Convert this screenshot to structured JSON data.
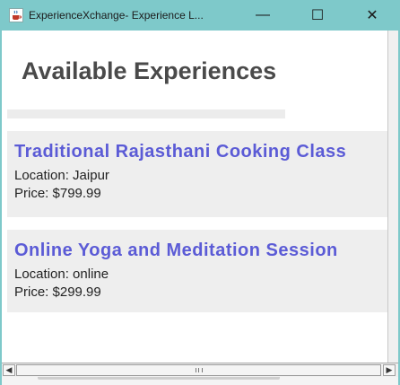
{
  "window": {
    "title": "ExperienceXchange- Experience L...",
    "min_glyph": "—",
    "max_glyph": "☐",
    "close_glyph": "✕",
    "icon": "java-cup-icon"
  },
  "page": {
    "title": "Available Experiences"
  },
  "experiences": [
    {
      "title": "Traditional Rajasthani Cooking Class",
      "location": "Location: Jaipur",
      "price": "Price: $799.99"
    },
    {
      "title": "Online Yoga and Meditation Session",
      "location": "Location: online",
      "price": "Price: $299.99"
    }
  ],
  "scrollbar": {
    "left_arrow": "◀",
    "right_arrow": "▶"
  },
  "colors": {
    "titlebar": "#7ec9ca",
    "card_title": "#5b5bd6",
    "card_background": "#eeeeee"
  }
}
